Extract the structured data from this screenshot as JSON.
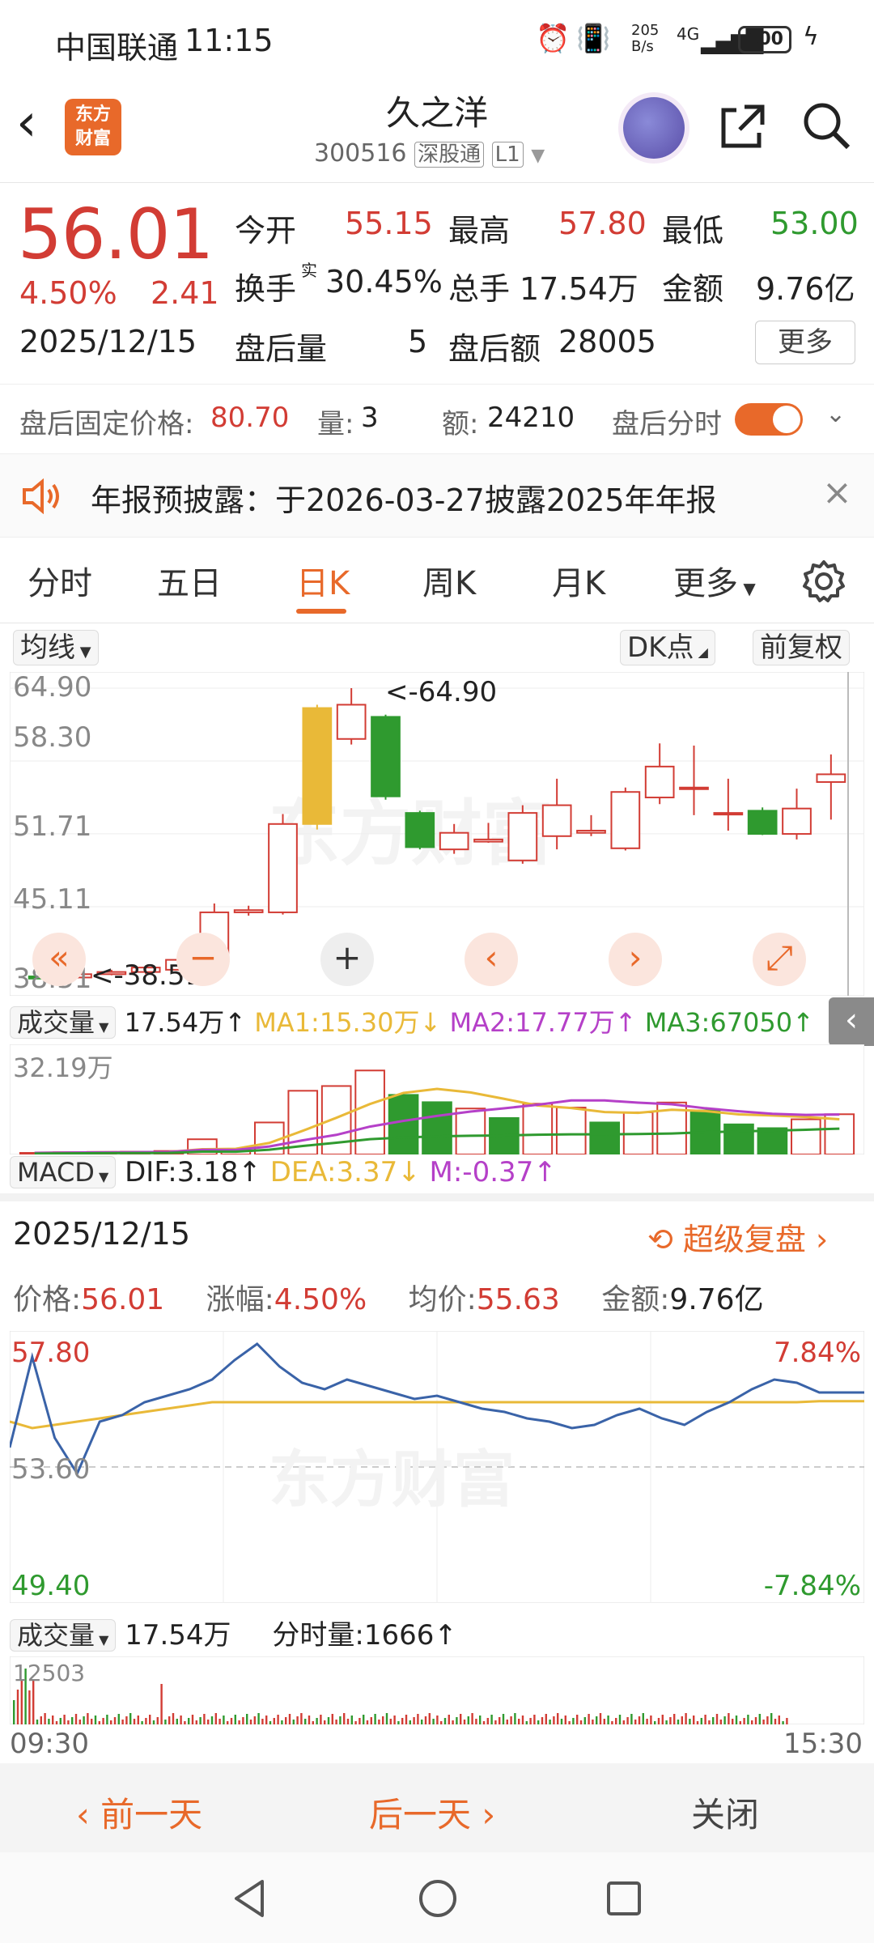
{
  "status_bar": {
    "carrier": "中国联通",
    "time": "11:15",
    "net_speed_top": "205",
    "net_speed_bottom": "B/s",
    "network": "4G",
    "battery": "100"
  },
  "header": {
    "logo_line1": "东方",
    "logo_line2": "财富",
    "stock_name": "久之洋",
    "stock_code": "300516",
    "badge_sgt": "深股通",
    "badge_level": "L1"
  },
  "quote": {
    "price": "56.01",
    "change_pct": "4.50%",
    "change": "2.41",
    "date": "2025/12/15",
    "open_label": "今开",
    "open": "55.15",
    "high_label": "最高",
    "high": "57.80",
    "low_label": "最低",
    "low": "53.00",
    "turnover_label": "换手",
    "turnover_sup": "实",
    "turnover": "30.45%",
    "volume_label": "总手",
    "volume": "17.54万",
    "amount_label": "金额",
    "amount": "9.76亿",
    "ah_vol_label": "盘后量",
    "ah_vol": "5",
    "ah_amt_label": "盘后额",
    "ah_amt": "28005",
    "more_button": "更多"
  },
  "after_hours": {
    "price_label": "盘后固定价格:",
    "price": "80.70",
    "qty_label": "量:",
    "qty": "3",
    "amt_label": "额:",
    "amt": "24210",
    "intraday_label": "盘后分时",
    "toggle_on": true
  },
  "banner": {
    "text": "年报预披露：于2026-03-27披露2025年年报"
  },
  "tabs": [
    {
      "label": "分时"
    },
    {
      "label": "五日"
    },
    {
      "label": "日K",
      "active": true
    },
    {
      "label": "周K"
    },
    {
      "label": "月K"
    },
    {
      "label": "更多"
    }
  ],
  "kline": {
    "ma_selector": "均线",
    "dk_button": "DK点",
    "adj_button": "前复权",
    "y_labels": [
      "64.90",
      "58.30",
      "51.71",
      "45.11",
      "38.51"
    ],
    "max_marker": "<-64.90",
    "min_marker": "<-38.51",
    "candles": [
      {
        "o": 38.6,
        "c": 38.8,
        "h": 39.0,
        "l": 38.51,
        "up": false
      },
      {
        "o": 38.7,
        "c": 39.0,
        "h": 39.3,
        "l": 38.6,
        "up": true
      },
      {
        "o": 39.0,
        "c": 39.2,
        "h": 39.4,
        "l": 38.9,
        "up": true
      },
      {
        "o": 39.2,
        "c": 39.6,
        "h": 39.8,
        "l": 39.0,
        "up": true
      },
      {
        "o": 39.4,
        "c": 40.3,
        "h": 40.8,
        "l": 39.2,
        "up": true
      },
      {
        "o": 40.5,
        "c": 44.6,
        "h": 45.4,
        "l": 40.3,
        "up": true
      },
      {
        "o": 44.6,
        "c": 44.8,
        "h": 45.2,
        "l": 44.3,
        "up": true
      },
      {
        "o": 44.6,
        "c": 52.6,
        "h": 53.5,
        "l": 44.4,
        "up": true
      },
      {
        "o": 52.6,
        "c": 63.1,
        "h": 63.4,
        "l": 52.1,
        "up": "gold"
      },
      {
        "o": 60.3,
        "c": 63.4,
        "h": 64.9,
        "l": 59.8,
        "up": true
      },
      {
        "o": 62.3,
        "c": 55.1,
        "h": 62.5,
        "l": 54.8,
        "up": false
      },
      {
        "o": 53.6,
        "c": 50.5,
        "h": 53.8,
        "l": 50.3,
        "up": false
      },
      {
        "o": 50.3,
        "c": 51.8,
        "h": 52.6,
        "l": 49.9,
        "up": true
      },
      {
        "o": 51.0,
        "c": 51.2,
        "h": 52.7,
        "l": 50.9,
        "up": true
      },
      {
        "o": 49.3,
        "c": 53.6,
        "h": 54.3,
        "l": 49.0,
        "up": true
      },
      {
        "o": 51.5,
        "c": 54.3,
        "h": 56.7,
        "l": 50.3,
        "up": true
      },
      {
        "o": 51.8,
        "c": 52.0,
        "h": 53.4,
        "l": 51.5,
        "up": true
      },
      {
        "o": 50.4,
        "c": 55.5,
        "h": 55.9,
        "l": 50.2,
        "up": true
      },
      {
        "o": 55.0,
        "c": 57.8,
        "h": 59.9,
        "l": 54.4,
        "up": true
      },
      {
        "o": 55.8,
        "c": 55.9,
        "h": 59.7,
        "l": 53.4,
        "up": true
      },
      {
        "o": 53.6,
        "c": 53.6,
        "h": 56.7,
        "l": 52.0,
        "up": true
      },
      {
        "o": 53.8,
        "c": 51.7,
        "h": 54.1,
        "l": 51.6,
        "up": false
      },
      {
        "o": 51.7,
        "c": 54.0,
        "h": 55.8,
        "l": 51.2,
        "up": true
      },
      {
        "o": 56.4,
        "c": 57.1,
        "h": 58.9,
        "l": 53.0,
        "up": true
      }
    ],
    "nav": {
      "first": "«",
      "zoom_out": "−",
      "zoom_in": "+",
      "prev": "‹",
      "next": "›",
      "fullscreen": "⤢"
    }
  },
  "volume_panel": {
    "selector": "成交量",
    "value": "17.54万↑",
    "ma1": "MA1:15.30万↓",
    "ma2": "MA2:17.77万↑",
    "ma3": "MA3:67050↑",
    "y_label": "32.19万",
    "bars": [
      0.5,
      0.7,
      0.8,
      0.9,
      1.1,
      4.8,
      1.3,
      10.1,
      20.1,
      21.6,
      26.5,
      18.8,
      16.5,
      14.5,
      11.5,
      16.0,
      14.8,
      10.1,
      13.3,
      16.4,
      13.9,
      9.5,
      8.3,
      11.1,
      12.7
    ],
    "bar_up": [
      true,
      true,
      true,
      true,
      true,
      true,
      true,
      true,
      true,
      true,
      true,
      false,
      false,
      true,
      false,
      true,
      true,
      false,
      true,
      true,
      false,
      false,
      false,
      true,
      true
    ]
  },
  "macd": {
    "selector": "MACD",
    "dif": "DIF:3.18↑",
    "dea": "DEA:3.37↓",
    "m": "M:-0.37↑"
  },
  "review": {
    "date": "2025/12/15",
    "link": "超级复盘",
    "price_label": "价格:",
    "price": "56.01",
    "chg_label": "涨幅:",
    "chg": "4.50%",
    "avg_label": "均价:",
    "avg": "55.63",
    "amt_label": "金额:",
    "amt": "9.76亿",
    "high": "57.80",
    "mid": "53.60",
    "low": "49.40",
    "pct_high": "7.84%",
    "pct_low": "-7.84%",
    "intraday_vol_label": "成交量",
    "intraday_vol": "17.54万",
    "tick_vol": "分时量:1666↑",
    "vol_max": "12503",
    "time_start": "09:30",
    "time_end": "15:30"
  },
  "bottom_bar": {
    "prev": "前一天",
    "next": "后一天",
    "close": "关闭"
  },
  "watermark": "东方财富",
  "colors": {
    "red": "#d23c34",
    "green": "#2f9a2f",
    "orange": "#e8692a",
    "gold": "#e9b938",
    "purple": "#b540c8",
    "blue": "#3a63a8"
  }
}
